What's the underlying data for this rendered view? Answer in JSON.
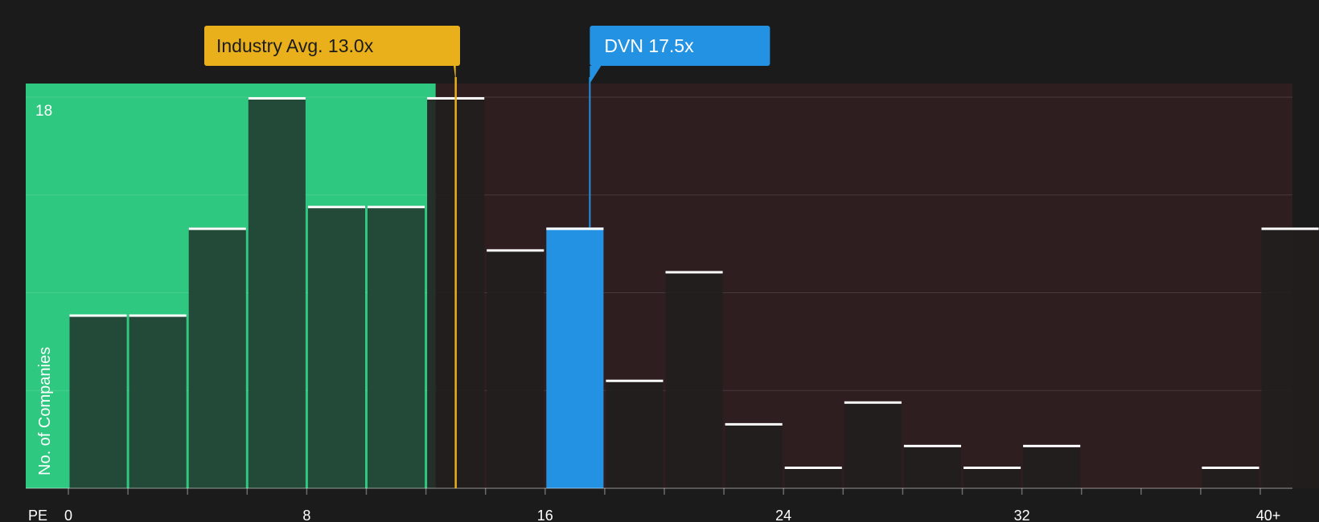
{
  "colors": {
    "background": "#1b1b1c",
    "below_zone": "#2ec880",
    "above_zone": "#2f1e1f",
    "bar_below": "#234a38",
    "bar_above": "#221e1e",
    "highlight": "#2492e2",
    "industry": "#e9b01c"
  },
  "chart_data": {
    "type": "bar",
    "title": "",
    "xlabel": "PE",
    "ylabel": "No. of Companies",
    "x_ticks": [
      "0",
      "8",
      "16",
      "24",
      "32",
      "40+"
    ],
    "y_tick_label": "18",
    "ylim": [
      0,
      18
    ],
    "bin_width": 2,
    "bins": [
      {
        "start": 0,
        "count": 8
      },
      {
        "start": 2,
        "count": 8
      },
      {
        "start": 4,
        "count": 12
      },
      {
        "start": 6,
        "count": 18
      },
      {
        "start": 8,
        "count": 13
      },
      {
        "start": 10,
        "count": 13
      },
      {
        "start": 12,
        "count": 18
      },
      {
        "start": 14,
        "count": 11
      },
      {
        "start": 16,
        "count": 12,
        "highlight": true
      },
      {
        "start": 18,
        "count": 5
      },
      {
        "start": 20,
        "count": 10
      },
      {
        "start": 22,
        "count": 3
      },
      {
        "start": 24,
        "count": 1
      },
      {
        "start": 26,
        "count": 4
      },
      {
        "start": 28,
        "count": 2
      },
      {
        "start": 30,
        "count": 1
      },
      {
        "start": 32,
        "count": 2
      },
      {
        "start": 34,
        "count": 0
      },
      {
        "start": 36,
        "count": 0
      },
      {
        "start": 38,
        "count": 1
      },
      {
        "start": 40,
        "count": 12
      }
    ],
    "industry_avg": {
      "value": 13.0,
      "label": "Industry Avg. 13.0x"
    },
    "company": {
      "value": 17.5,
      "label": "DVN 17.5x"
    }
  }
}
